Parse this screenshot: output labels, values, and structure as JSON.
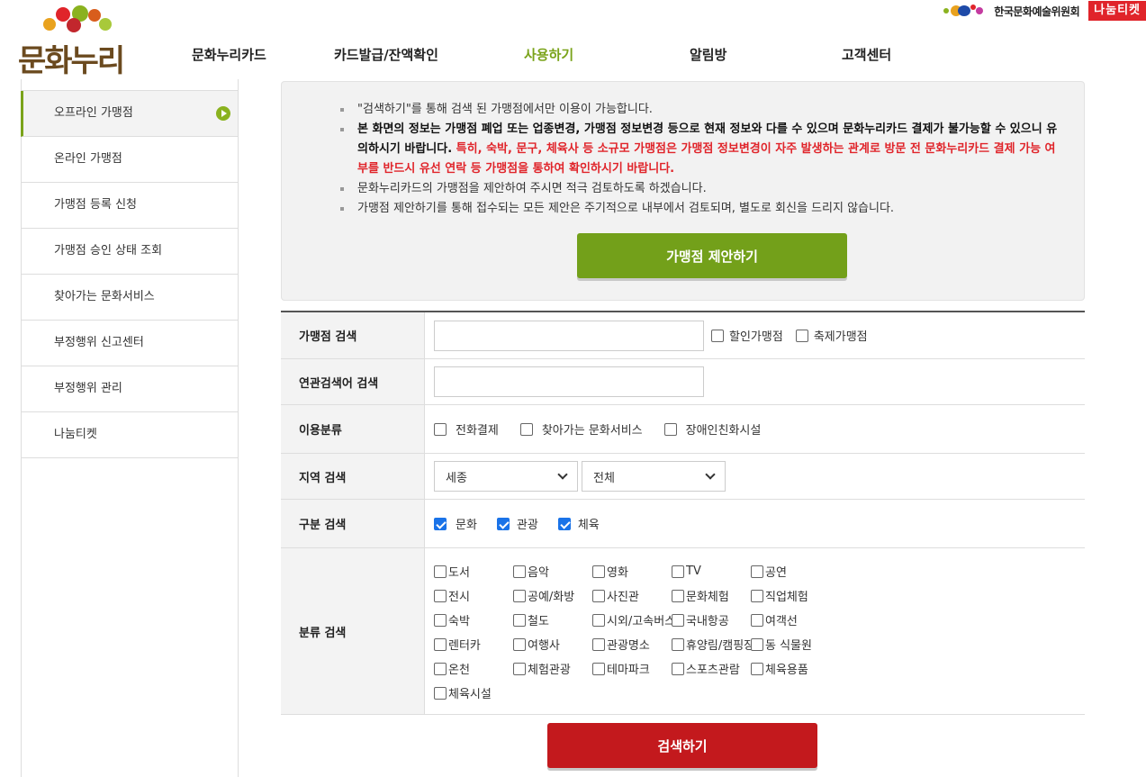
{
  "header": {
    "logo_text": "문화누리",
    "nav": [
      "문화누리카드",
      "카드발급/잔액확인",
      "사용하기",
      "알림방",
      "고객센터"
    ],
    "active_nav": "사용하기",
    "arko_text": "한국문화예술위원회",
    "nanum_badge": "나눔티켓"
  },
  "sidebar": {
    "items": [
      {
        "label": "오프라인 가맹점",
        "active": true
      },
      {
        "label": "온라인 가맹점"
      },
      {
        "label": "가맹점 등록 신청"
      },
      {
        "label": "가맹점 승인 상태 조회"
      },
      {
        "label": "찾아가는 문화서비스"
      },
      {
        "label": "부정행위 신고센터"
      },
      {
        "label": "부정행위 관리"
      },
      {
        "label": "나눔티켓"
      }
    ]
  },
  "notice": {
    "line1": "\"검색하기\"를 통해 검색 된 가맹점에서만 이용이 가능합니다.",
    "line2_bold": "본 화면의 정보는 가맹점 폐업 또는 업종변경, 가맹점 정보변경 등으로 현재 정보와 다를 수 있으며 문화누리카드 결제가 불가능할 수 있으니 유의하시기 바랍니다.",
    "line2_red": " 특히, 숙박, 문구, 체육사 등 소규모 가맹점은 가맹점 정보변경이 자주 발생하는 관계로 방문 전 문화누리카드 결제 가능 여부를 반드시 유선 연락 등 가맹점을 통하여 확인하시기 바랍니다.",
    "line3": "문화누리카드의 가맹점을 제안하여 주시면 적극 검토하도록 하겠습니다.",
    "line4": "가맹점 제안하기를 통해 접수되는 모든 제안은 주기적으로 내부에서 검토되며, 별도로 회신을 드리지 않습니다.",
    "suggest_button": "가맹점 제안하기"
  },
  "search": {
    "store_label": "가맹점 검색",
    "store_value": "",
    "store_options": [
      "할인가맹점",
      "축제가맹점"
    ],
    "keyword_label": "연관검색어 검색",
    "keyword_value": "",
    "usage_label": "이용분류",
    "usage_options": [
      "전화결제",
      "찾아가는 문화서비스",
      "장애인친화시설"
    ],
    "region_label": "지역 검색",
    "region_selected": "세종",
    "region_sub_selected": "전체",
    "type_label": "구분 검색",
    "type_options": [
      "문화",
      "관광",
      "체육"
    ],
    "category_label": "분류 검색",
    "categories": [
      "도서",
      "음악",
      "영화",
      "TV",
      "공연",
      "전시",
      "공예/화방",
      "사진관",
      "문화체험",
      "직업체험",
      "숙박",
      "철도",
      "시외/고속버스",
      "국내항공",
      "여객선",
      "렌터카",
      "여행사",
      "관광명소",
      "휴양림/캠핑장",
      "동 식물원",
      "온천",
      "체험관광",
      "테마파크",
      "스포츠관람",
      "체육용품",
      "체육시설"
    ],
    "search_button": "검색하기"
  }
}
